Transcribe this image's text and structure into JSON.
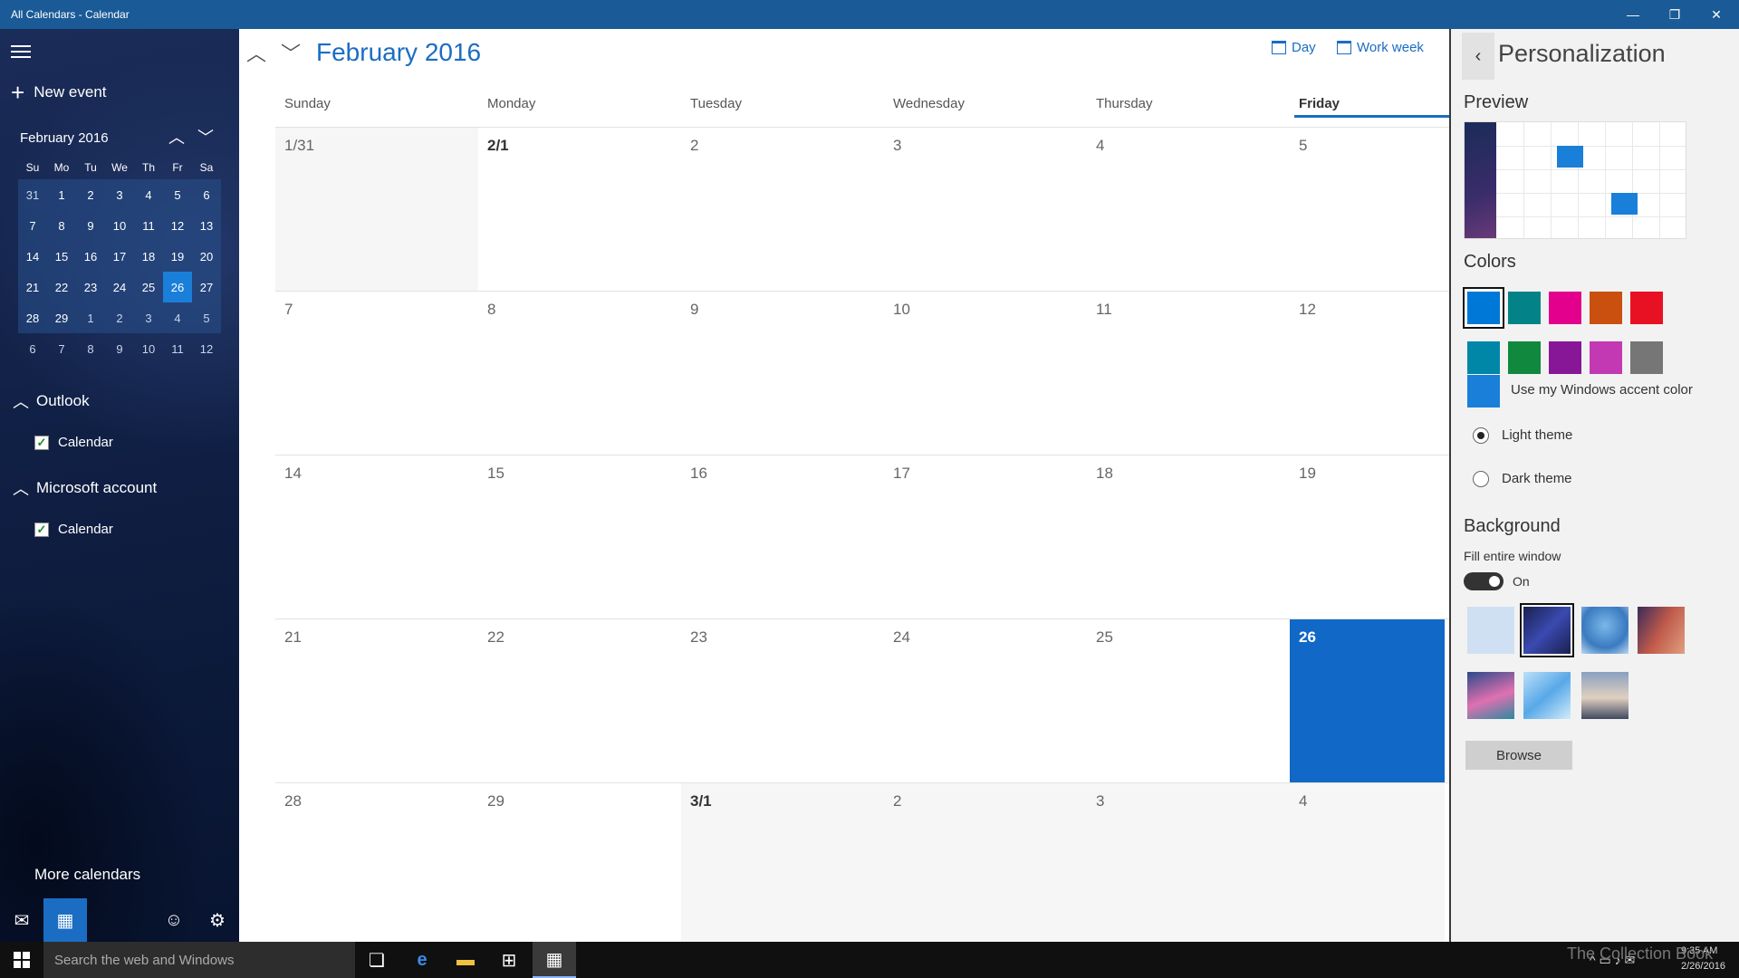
{
  "window": {
    "title": "All Calendars - Calendar",
    "minimize_icon": "—",
    "restore_icon": "❐",
    "close_icon": "✕"
  },
  "sidebar": {
    "new_event": "New event",
    "mini_calendar": {
      "month": "February 2016",
      "weekdays": [
        "Su",
        "Mo",
        "Tu",
        "We",
        "Th",
        "Fr",
        "Sa"
      ],
      "weeks": [
        [
          "31",
          "1",
          "2",
          "3",
          "4",
          "5",
          "6"
        ],
        [
          "7",
          "8",
          "9",
          "10",
          "11",
          "12",
          "13"
        ],
        [
          "14",
          "15",
          "16",
          "17",
          "18",
          "19",
          "20"
        ],
        [
          "21",
          "22",
          "23",
          "24",
          "25",
          "26",
          "27"
        ],
        [
          "28",
          "29",
          "1",
          "2",
          "3",
          "4",
          "5"
        ],
        [
          "6",
          "7",
          "8",
          "9",
          "10",
          "11",
          "12"
        ]
      ],
      "selected": "26"
    },
    "accounts": [
      {
        "name": "Outlook",
        "calendar": "Calendar"
      },
      {
        "name": "Microsoft account",
        "calendar": "Calendar"
      }
    ],
    "more_calendars": "More calendars"
  },
  "main": {
    "month_title": "February 2016",
    "views": [
      "Day",
      "Work week"
    ],
    "days": [
      "Sunday",
      "Monday",
      "Tuesday",
      "Wednesday",
      "Thursday",
      "Friday"
    ],
    "weeks": [
      [
        "1/31",
        "2/1",
        "2",
        "3",
        "4",
        "5"
      ],
      [
        "7",
        "8",
        "9",
        "10",
        "11",
        "12"
      ],
      [
        "14",
        "15",
        "16",
        "17",
        "18",
        "19"
      ],
      [
        "21",
        "22",
        "23",
        "24",
        "25",
        "26"
      ],
      [
        "28",
        "29",
        "3/1",
        "2",
        "3",
        "4"
      ]
    ],
    "today": "26"
  },
  "panel": {
    "title": "Personalization",
    "preview_label": "Preview",
    "colors_label": "Colors",
    "colors": [
      "#0078d7",
      "#038387",
      "#e3008c",
      "#ca5010",
      "#e81123",
      "#0087a8",
      "#10893e",
      "#881798",
      "#c239b3",
      "#767676"
    ],
    "accent_label": "Use my Windows accent color",
    "light_theme": "Light theme",
    "dark_theme": "Dark theme",
    "background_label": "Background",
    "fill_label": "Fill entire window",
    "toggle_state": "On",
    "browse": "Browse"
  },
  "taskbar": {
    "search_placeholder": "Search the web and Windows",
    "time": "9:35 AM",
    "date": "2/26/2016"
  },
  "watermark": "The Collection Book"
}
